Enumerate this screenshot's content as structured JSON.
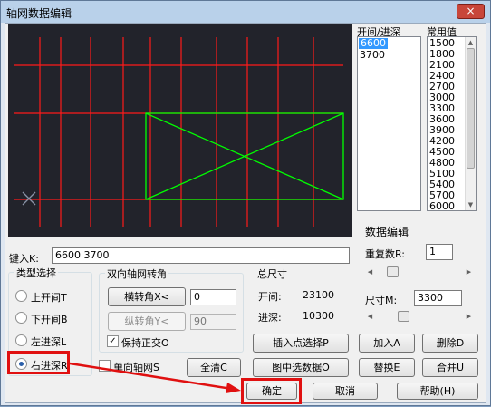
{
  "window": {
    "title": "轴网数据编辑",
    "close_label": "×"
  },
  "spacing_list": {
    "header": "开间/进深",
    "items": [
      "6600",
      "3700"
    ],
    "selected": "6600"
  },
  "common_values": {
    "header": "常用值",
    "items": [
      "1500",
      "1800",
      "2100",
      "2400",
      "2700",
      "3000",
      "3300",
      "3600",
      "3900",
      "4200",
      "4500",
      "4800",
      "5100",
      "5400",
      "5700",
      "6000"
    ]
  },
  "data_edit": {
    "title": "数据编辑",
    "repeat_label": "重复数R:",
    "repeat_value": "1",
    "size_label": "尺寸M:",
    "size_value": "3300"
  },
  "input": {
    "label": "键入K:",
    "value": "6600  3700"
  },
  "type_select": {
    "title": "类型选择",
    "options": [
      "上开间T",
      "下开间B",
      "左进深L",
      "右进深R"
    ],
    "selected": "右进深R"
  },
  "rotation": {
    "title": "双向轴网转角",
    "horiz_button": "横转角X<",
    "horiz_value": "0",
    "vert_button": "纵转角Y<",
    "vert_value": "90",
    "vert_enabled": false,
    "keep_ortho_label": "保持正交O",
    "keep_ortho_checked": true
  },
  "totals": {
    "title": "总尺寸",
    "bay_label": "开间:",
    "bay_value": "23100",
    "depth_label": "进深:",
    "depth_value": "10300"
  },
  "actions": {
    "insert_point": "插入点选择P",
    "add": "加入A",
    "delete": "删除D",
    "pick_from_drawing": "图中选数据O",
    "replace": "替换E",
    "merge": "合并U",
    "single_axis_label": "单向轴网S",
    "single_axis_checked": false,
    "clear_all": "全清C"
  },
  "footer": {
    "ok": "确定",
    "cancel": "取消",
    "help": "帮助(H)"
  },
  "colors": {
    "canvas_bg": "#22232b",
    "axis_line": "#ff1a1a",
    "building_outline": "#00ff00",
    "origin_marker": "#8a93a6",
    "highlight": "#e01010",
    "selection": "#3399ff"
  }
}
